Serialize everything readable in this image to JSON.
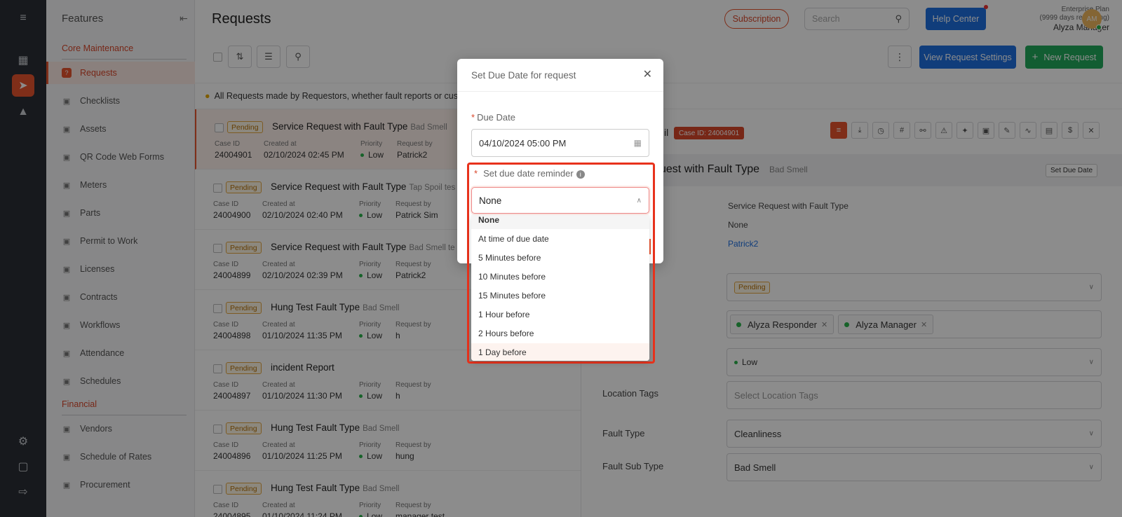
{
  "sidebar": {
    "title": "Features",
    "sections": [
      {
        "title": "Core Maintenance",
        "items": [
          "Requests",
          "Checklists",
          "Assets",
          "QR Code Web Forms",
          "Meters",
          "Parts",
          "Permit to Work",
          "Licenses",
          "Contracts",
          "Workflows",
          "Attendance",
          "Schedules"
        ]
      },
      {
        "title": "Financial",
        "items": [
          "Vendors",
          "Schedule of Rates",
          "Procurement"
        ]
      }
    ],
    "icons": [
      "request-icon",
      "checklist-icon",
      "asset-icon",
      "qr-code-icon",
      "meter-icon",
      "parts-icon",
      "permit-icon",
      "license-icon",
      "contract-icon",
      "workflow-icon",
      "attendance-icon",
      "calendar-icon",
      "vendor-icon",
      "dollar-icon",
      "procurement-icon"
    ]
  },
  "header": {
    "title": "Requests",
    "subscription": "Subscription",
    "search_placeholder": "Search",
    "help": "Help Center",
    "plan": "Enterprise Plan",
    "days": "(9999 days remaining)",
    "user": "Alyza Manager",
    "avatar": "AM"
  },
  "toolbar": {
    "view_settings": "View Request Settings",
    "new_request": "New Request"
  },
  "banner": "All Requests made by Requestors, whether fault reports or custom",
  "labels": {
    "case_id": "Case ID",
    "created_at": "Created at",
    "priority": "Priority",
    "request_by": "Request by"
  },
  "requests": [
    {
      "status": "Pending",
      "title": "Service Request with Fault Type",
      "sub": "Bad Smell",
      "case_id": "24004901",
      "created": "02/10/2024 02:45 PM",
      "priority": "Low",
      "by": "Patrick2"
    },
    {
      "status": "Pending",
      "title": "Service Request with Fault Type",
      "sub": "Tap Spoil   tes",
      "case_id": "24004900",
      "created": "02/10/2024 02:40 PM",
      "priority": "Low",
      "by": "Patrick Sim"
    },
    {
      "status": "Pending",
      "title": "Service Request with Fault Type",
      "sub": "Bad Smell   te",
      "case_id": "24004899",
      "created": "02/10/2024 02:39 PM",
      "priority": "Low",
      "by": "Patrick2"
    },
    {
      "status": "Pending",
      "title": "Hung Test Fault Type",
      "sub": "Bad Smell",
      "case_id": "24004898",
      "created": "01/10/2024 11:35 PM",
      "priority": "Low",
      "by": "h"
    },
    {
      "status": "Pending",
      "title": "incident Report",
      "sub": "",
      "case_id": "24004897",
      "created": "01/10/2024 11:30 PM",
      "priority": "Low",
      "by": "h"
    },
    {
      "status": "Pending",
      "title": "Hung Test Fault Type",
      "sub": "Bad Smell",
      "case_id": "24004896",
      "created": "01/10/2024 11:25 PM",
      "priority": "Low",
      "by": "hung"
    },
    {
      "status": "Pending",
      "title": "Hung Test Fault Type",
      "sub": "Bad Smell",
      "case_id": "24004895",
      "created": "01/10/2024 11:24 PM",
      "priority": "Low",
      "by": "manager test"
    }
  ],
  "detail": {
    "title_fragment": "il",
    "case_badge": "Case ID: 24004901",
    "heading": "uest with Fault Type",
    "heading_sub": "Bad Smell",
    "set_due": "Set Due Date",
    "type_value": "Service Request with Fault Type",
    "none_value": "None",
    "requester": "Patrick2",
    "status": "Pending",
    "assignees": [
      "Alyza Responder",
      "Alyza Manager"
    ],
    "priority": "Low",
    "location_label": "Location Tags",
    "location_placeholder": "Select Location Tags",
    "fault_type_label": "Fault Type",
    "fault_type": "Cleanliness",
    "fault_sub_label": "Fault Sub Type",
    "fault_sub": "Bad Smell",
    "icons": [
      "details-icon",
      "download-icon",
      "clock-icon",
      "hash-icon",
      "link-icon",
      "warning-icon",
      "puzzle-icon",
      "camera-icon",
      "edit-icon",
      "signature-icon",
      "store-icon",
      "dollar-icon",
      "trash-icon"
    ]
  },
  "modal": {
    "title": "Set Due Date for request",
    "due_label": "Due Date",
    "due_value": "04/10/2024 05:00 PM",
    "reminder_label": "Set due date reminder",
    "reminder_value": "None",
    "options": [
      "None",
      "At time of due date",
      "5 Minutes before",
      "10 Minutes before",
      "15 Minutes before",
      "1 Hour before",
      "2 Hours before",
      "1 Day before"
    ]
  },
  "colors": {
    "accent": "#e8542f",
    "primary_blue": "#1e6fe0",
    "success_green": "#22a95c"
  }
}
